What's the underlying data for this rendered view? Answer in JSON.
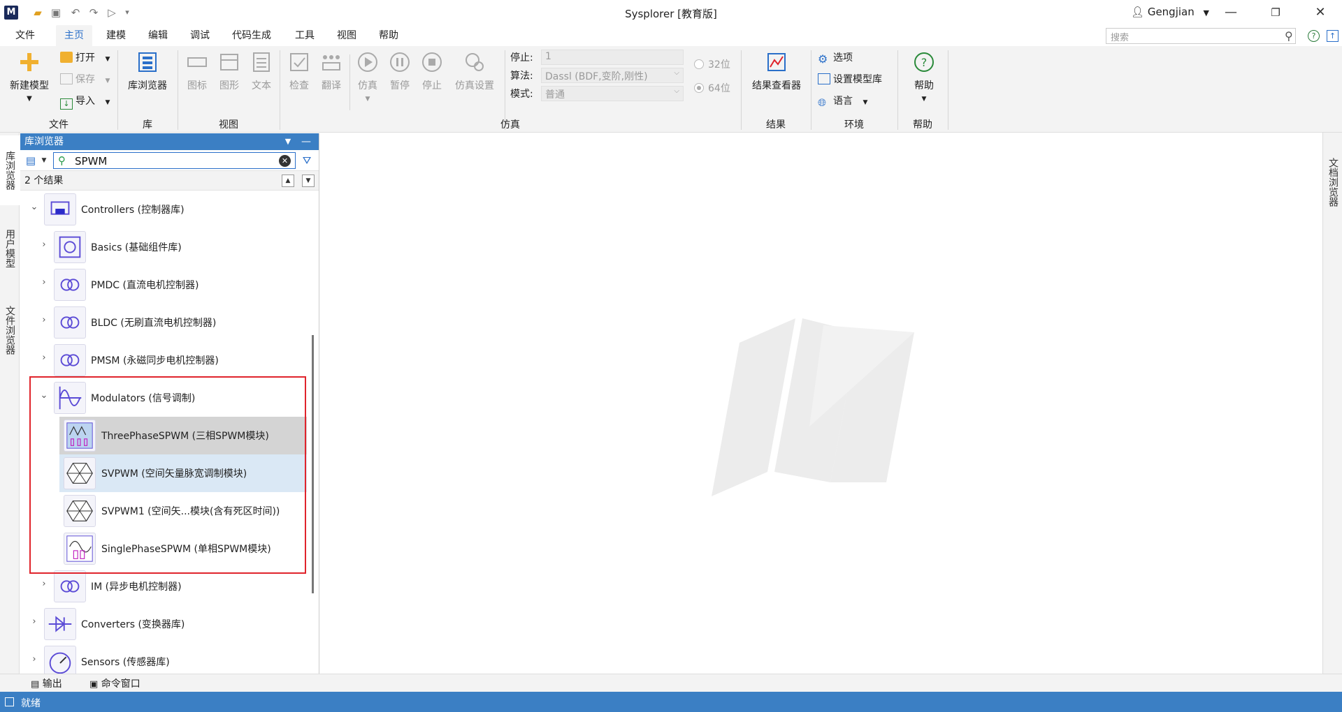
{
  "window": {
    "title": "Sysplorer [教育版]",
    "user": "Gengjian",
    "logo_letter": "M"
  },
  "menu": {
    "tabs": [
      "文件",
      "主页",
      "建模",
      "编辑",
      "调试",
      "代码生成",
      "工具",
      "视图",
      "帮助"
    ],
    "active_index": 1,
    "search_placeholder": "搜索"
  },
  "ribbon": {
    "file": {
      "group": "文件",
      "new_model": "新建模型",
      "open": "打开",
      "save": "保存",
      "import": "导入"
    },
    "lib": {
      "group": "库",
      "browser": "库浏览器"
    },
    "view": {
      "group": "视图",
      "icon": "图标",
      "diagram": "图形",
      "text": "文本"
    },
    "sim": {
      "group": "仿真",
      "check": "检查",
      "translate": "翻译",
      "simulate": "仿真",
      "pause": "暂停",
      "stop": "停止",
      "settings": "仿真设置",
      "stop_label": "停止:",
      "stop_value": "1",
      "algo_label": "算法:",
      "algo_value": "Dassl (BDF,变阶,刚性)",
      "mode_label": "模式:",
      "mode_value": "普通",
      "bit32": "32位",
      "bit64": "64位"
    },
    "result": {
      "group": "结果",
      "viewer": "结果查看器"
    },
    "env": {
      "group": "环境",
      "options": "选项",
      "set_lib": "设置模型库",
      "language": "语言"
    },
    "help": {
      "group": "帮助",
      "help": "帮助"
    }
  },
  "side_tabs": {
    "left": [
      "库浏览器",
      "用户模型",
      "文件浏览器"
    ],
    "right": [
      "文档浏览器"
    ]
  },
  "library_browser": {
    "title": "库浏览器",
    "search_value": "SPWM",
    "results_count": "2 个结果",
    "tree": [
      {
        "label": "Controllers (控制器库)",
        "level": 0,
        "expanded": true
      },
      {
        "label": "Basics (基础组件库)",
        "level": 1,
        "expanded": false
      },
      {
        "label": "PMDC (直流电机控制器)",
        "level": 1,
        "expanded": false
      },
      {
        "label": "BLDC (无刷直流电机控制器)",
        "level": 1,
        "expanded": false
      },
      {
        "label": "PMSM (永磁同步电机控制器)",
        "level": 1,
        "expanded": false
      },
      {
        "label": "Modulators (信号调制)",
        "level": 1,
        "expanded": true
      },
      {
        "label": "ThreePhaseSPWM (三相SPWM模块)",
        "level": 2,
        "state": "selected"
      },
      {
        "label": "SVPWM (空间矢量脉宽调制模块)",
        "level": 2,
        "state": "hover"
      },
      {
        "label": "SVPWM1 (空间矢...模块(含有死区时间))",
        "level": 2
      },
      {
        "label": "SinglePhaseSPWM (单相SPWM模块)",
        "level": 2
      },
      {
        "label": "IM (异步电机控制器)",
        "level": 1,
        "expanded": false
      },
      {
        "label": "Converters (变换器库)",
        "level": 0,
        "expanded": false
      },
      {
        "label": "Sensors (传感器库)",
        "level": 0,
        "expanded": false
      }
    ]
  },
  "bottom_tabs": {
    "output": "输出",
    "command": "命令窗口"
  },
  "status": {
    "text": "就绪"
  },
  "colors": {
    "accent": "#3b7fc4",
    "highlight_border": "#e0242c"
  }
}
